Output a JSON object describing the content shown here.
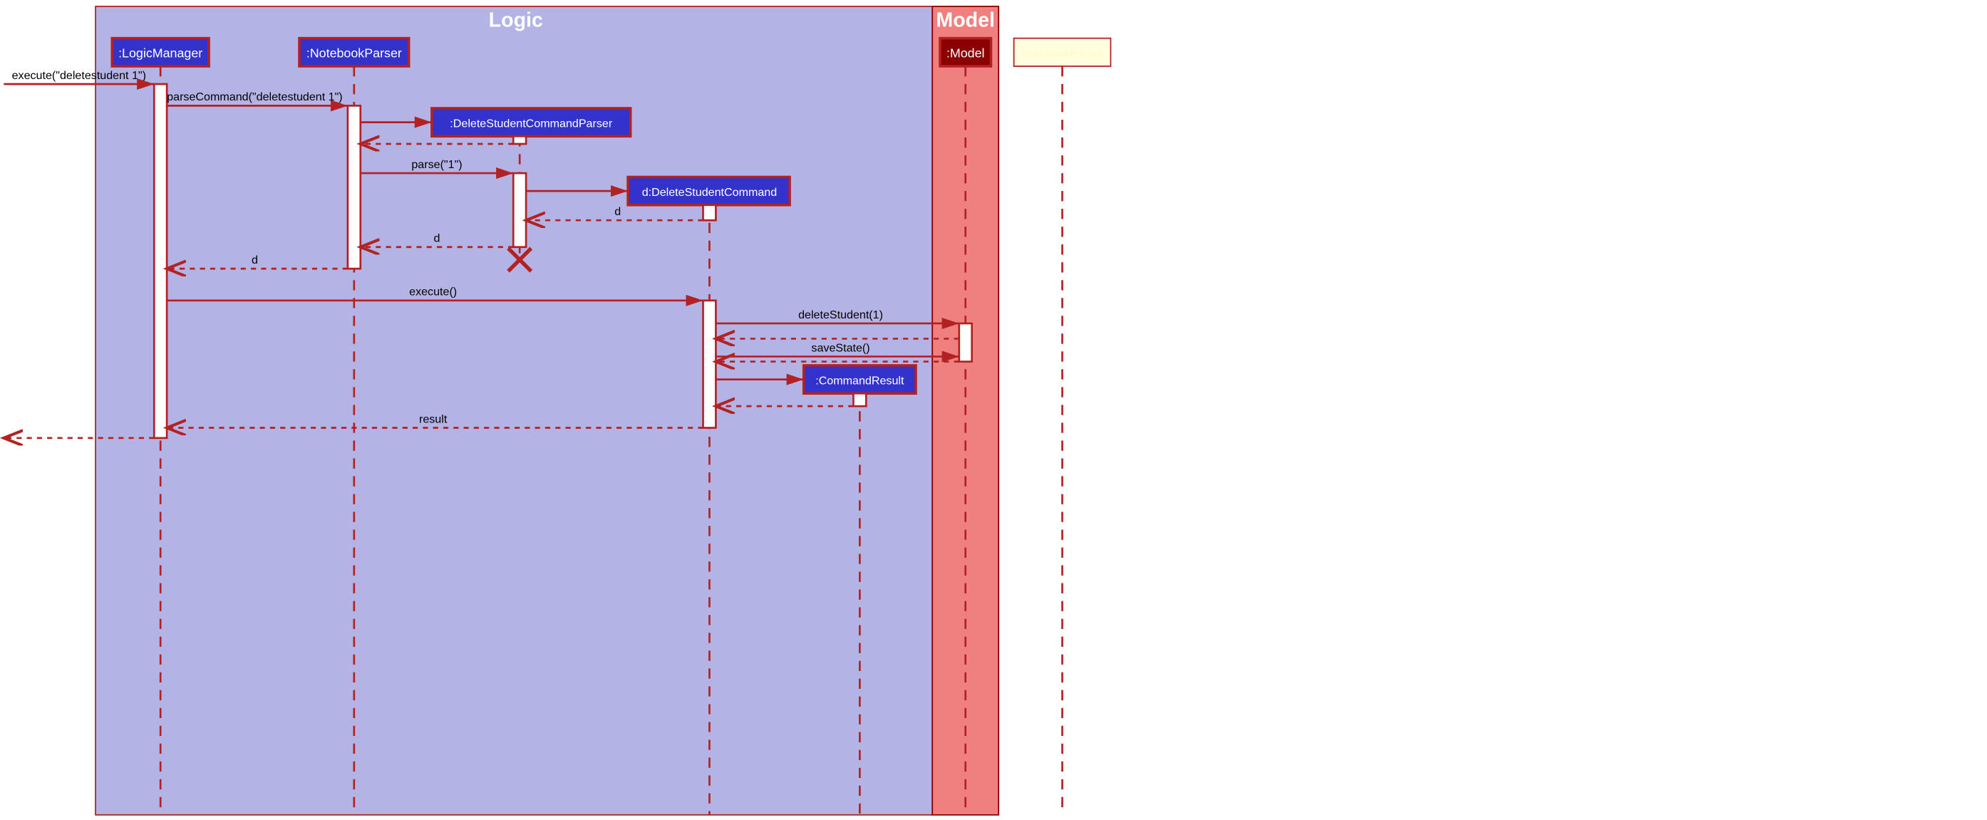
{
  "frames": {
    "logic": "Logic",
    "model": "Model"
  },
  "participants": {
    "logicManager": ":LogicManager",
    "notebookParser": ":NotebookParser",
    "deleteParser": ":DeleteStudentCommandParser",
    "deleteCommand": "d:DeleteStudentCommand",
    "model": ":Model",
    "commandResult": ":CommandResult",
    "extra": "NotebookParser"
  },
  "messages": {
    "execute1": "execute(\"deletestudent 1\")",
    "parseCommand": "parseCommand(\"deletestudent 1\")",
    "parse": "parse(\"1\")",
    "d1": "d",
    "d2": "d",
    "d3": "d",
    "execute2": "execute()",
    "deleteStudent": "deleteStudent(1)",
    "saveState": "saveState()",
    "result": "result"
  }
}
